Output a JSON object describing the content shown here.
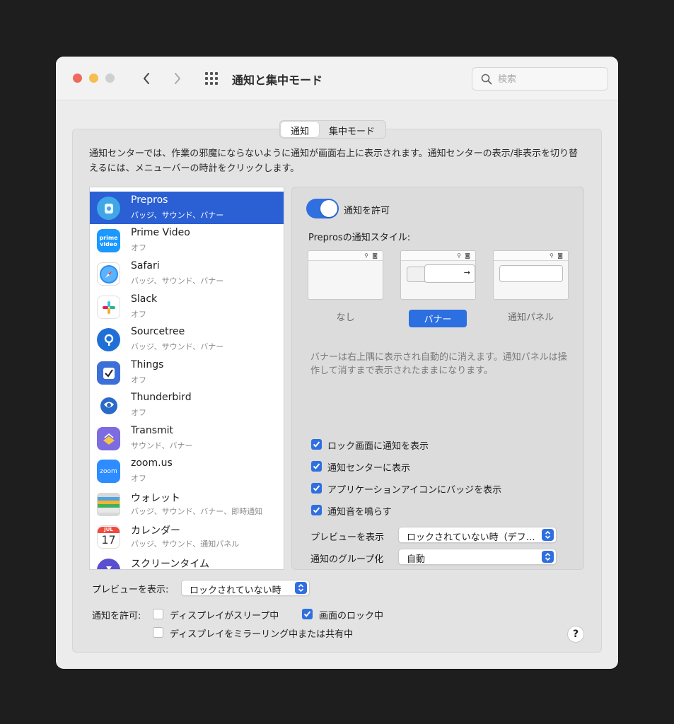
{
  "window": {
    "title": "通知と集中モード",
    "search_placeholder": "検索"
  },
  "tabs": [
    {
      "label": "通知",
      "active": true
    },
    {
      "label": "集中モード",
      "active": false
    }
  ],
  "description": "通知センターでは、作業の邪魔にならないように通知が画面右上に表示されます。通知センターの表示/非表示を切り替えるには、メニューバーの時計をクリックします。",
  "apps": [
    {
      "name": "Prepros",
      "status": "バッジ、サウンド、バナー",
      "selected": true,
      "icon": "prepros-icon",
      "color": "#3fa7e8"
    },
    {
      "name": "Prime Video",
      "status": "オフ",
      "icon": "prime-video-icon",
      "color": "#1a98ff"
    },
    {
      "name": "Safari",
      "status": "バッジ、サウンド、バナー",
      "icon": "safari-icon",
      "color": "#1e7cf0"
    },
    {
      "name": "Slack",
      "status": "オフ",
      "icon": "slack-icon",
      "color": "#ffffff"
    },
    {
      "name": "Sourcetree",
      "status": "バッジ、サウンド、バナー",
      "icon": "sourcetree-icon",
      "color": "#1f6fd6"
    },
    {
      "name": "Things",
      "status": "オフ",
      "icon": "things-icon",
      "color": "#3d6fd8"
    },
    {
      "name": "Thunderbird",
      "status": "オフ",
      "icon": "thunderbird-icon",
      "color": "#2a6ac8"
    },
    {
      "name": "Transmit",
      "status": "サウンド、バナー",
      "icon": "transmit-icon",
      "color": "#7d6be0"
    },
    {
      "name": "zoom.us",
      "status": "オフ",
      "icon": "zoom-icon",
      "color": "#2d8cff"
    },
    {
      "name": "ウォレット",
      "status": "バッジ、サウンド、バナー、即時通知",
      "icon": "wallet-icon",
      "color": "#2c2c2c"
    },
    {
      "name": "カレンダー",
      "status": "バッジ、サウンド、通知パネル",
      "icon": "calendar-icon",
      "color": "#ffffff",
      "month": "JUL",
      "day": "17"
    },
    {
      "name": "スクリーンタイム",
      "status": "",
      "icon": "screen-time-icon",
      "color": "#5a4fcf"
    }
  ],
  "detail": {
    "allow_label": "通知を許可",
    "allow_on": true,
    "style_title": "Preprosの通知スタイル:",
    "styles": [
      {
        "label": "なし",
        "selected": false
      },
      {
        "label": "バナー",
        "selected": true
      },
      {
        "label": "通知パネル",
        "selected": false
      }
    ],
    "hint": "バナーは右上隅に表示され自動的に消えます。通知パネルは操作して消すまで表示されたままになります。",
    "checks": [
      {
        "label": "ロック画面に通知を表示",
        "checked": true
      },
      {
        "label": "通知センターに表示",
        "checked": true
      },
      {
        "label": "アプリケーションアイコンにバッジを表示",
        "checked": true
      },
      {
        "label": "通知音を鳴らす",
        "checked": true
      }
    ],
    "preview_label": "プレビューを表示",
    "preview_value": "ロックされていない時（デフ…",
    "group_label": "通知のグループ化",
    "group_value": "自動"
  },
  "bottom": {
    "preview_label": "プレビューを表示:",
    "preview_value": "ロックされていない時",
    "allow_label": "通知を許可:",
    "options": [
      {
        "label": "ディスプレイがスリープ中",
        "checked": false
      },
      {
        "label": "画面のロック中",
        "checked": true
      },
      {
        "label": "ディスプレイをミラーリング中または共有中",
        "checked": false
      }
    ],
    "help": "?"
  },
  "colors": {
    "accent": "#2f6fe0",
    "selection": "#2b5fd4",
    "traffic_red": "#ed6a5e",
    "traffic_yellow": "#f4bf4f"
  }
}
